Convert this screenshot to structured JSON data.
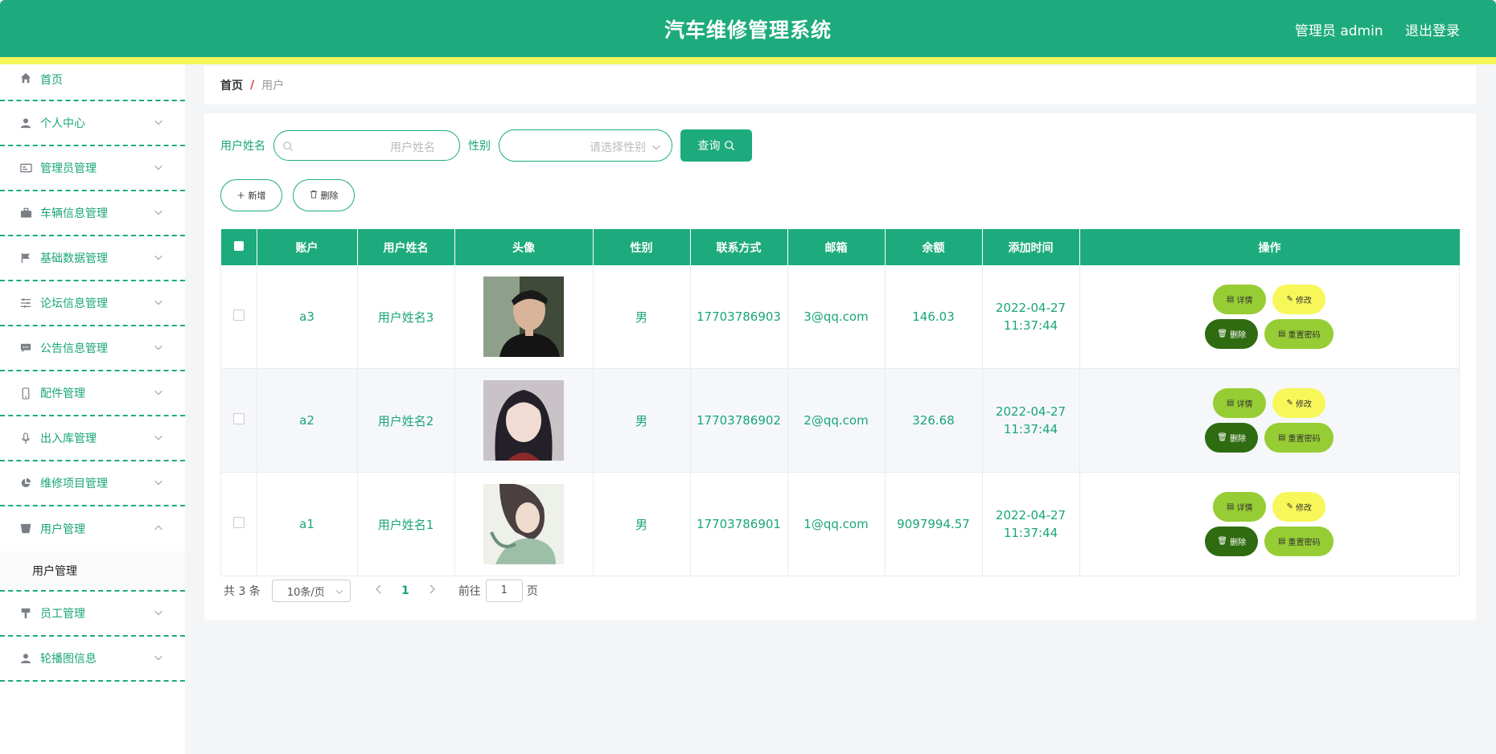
{
  "header": {
    "title": "汽车维修管理系统",
    "user_label": "管理员 admin",
    "logout_label": "退出登录"
  },
  "sidebar": {
    "items": [
      {
        "label": "首页",
        "icon": "home-icon"
      },
      {
        "label": "个人中心",
        "icon": "user-icon"
      },
      {
        "label": "管理员管理",
        "icon": "id-card-icon"
      },
      {
        "label": "车辆信息管理",
        "icon": "briefcase-icon"
      },
      {
        "label": "基础数据管理",
        "icon": "flag-icon"
      },
      {
        "label": "论坛信息管理",
        "icon": "sliders-icon"
      },
      {
        "label": "公告信息管理",
        "icon": "chat-icon"
      },
      {
        "label": "配件管理",
        "icon": "phone-icon"
      },
      {
        "label": "出入库管理",
        "icon": "mic-icon"
      },
      {
        "label": "维修项目管理",
        "icon": "pie-icon"
      },
      {
        "label": "用户管理",
        "icon": "box-icon"
      },
      {
        "label": "员工管理",
        "icon": "brush-icon"
      },
      {
        "label": "轮播图信息",
        "icon": "user-icon"
      }
    ],
    "submenu_label": "用户管理"
  },
  "breadcrumb": {
    "home": "首页",
    "sep": "/",
    "current": "用户"
  },
  "search": {
    "name_label": "用户姓名",
    "name_placeholder": "用户姓名",
    "gender_label": "性别",
    "gender_placeholder": "请选择性别",
    "query_label": "查询"
  },
  "actions": {
    "add_label": "新增",
    "delete_label": "删除"
  },
  "table": {
    "columns": [
      "账户",
      "用户姓名",
      "头像",
      "性别",
      "联系方式",
      "邮箱",
      "余额",
      "添加时间",
      "操作"
    ],
    "rows": [
      {
        "account": "a3",
        "name": "用户姓名3",
        "gender": "男",
        "phone": "17703786903",
        "email": "3@qq.com",
        "balance": "146.03",
        "time": "2022-04-27 11:37:44"
      },
      {
        "account": "a2",
        "name": "用户姓名2",
        "gender": "男",
        "phone": "17703786902",
        "email": "2@qq.com",
        "balance": "326.68",
        "time": "2022-04-27 11:37:44"
      },
      {
        "account": "a1",
        "name": "用户姓名1",
        "gender": "男",
        "phone": "17703786901",
        "email": "1@qq.com",
        "balance": "9097994.57",
        "time": "2022-04-27 11:37:44"
      }
    ],
    "ops": {
      "detail": "详情",
      "edit": "修改",
      "delete": "删除",
      "reset": "重置密码"
    }
  },
  "pager": {
    "total_label": "共 3 条",
    "page_size": "10条/页",
    "current_page": "1",
    "goto_label": "前往",
    "goto_value": "1",
    "page_suffix": "页"
  },
  "colors": {
    "primary": "#1dab7d",
    "stripe": "#f5f55a",
    "detail": "#97cd34",
    "edit": "#f7f759",
    "delete": "#2e6b11"
  }
}
